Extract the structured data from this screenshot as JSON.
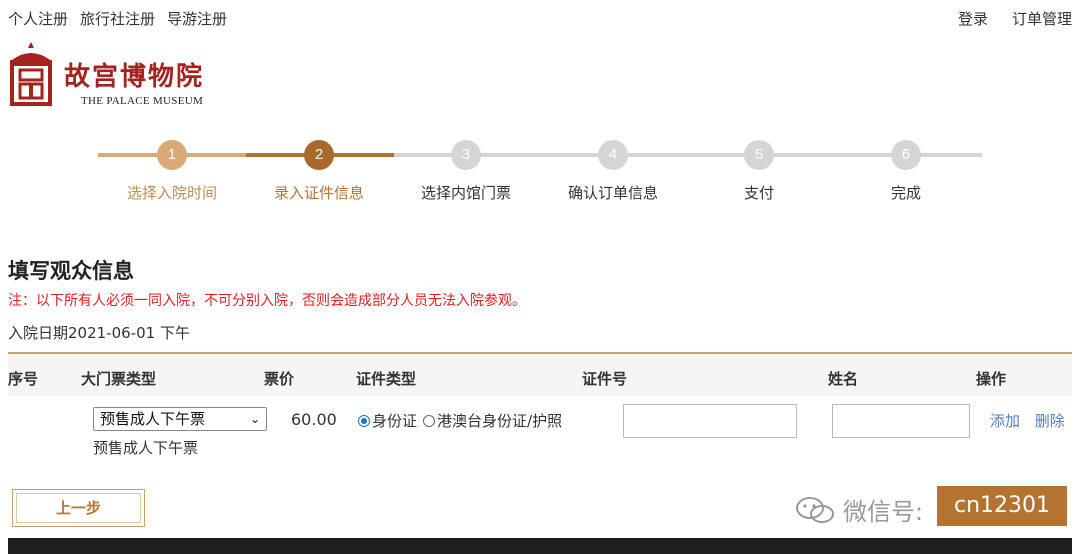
{
  "topnav": {
    "left": [
      "个人注册",
      "旅行社注册",
      "导游注册"
    ],
    "right": [
      "登录",
      "订单管理"
    ]
  },
  "logo": {
    "cn": "故宫博物院",
    "en": "THE PALACE MUSEUM"
  },
  "steps": [
    {
      "num": "1",
      "label": "选择入院时间",
      "state": "done"
    },
    {
      "num": "2",
      "label": "录入证件信息",
      "state": "active"
    },
    {
      "num": "3",
      "label": "选择内馆门票",
      "state": "todo"
    },
    {
      "num": "4",
      "label": "确认订单信息",
      "state": "todo"
    },
    {
      "num": "5",
      "label": "支付",
      "state": "todo"
    },
    {
      "num": "6",
      "label": "完成",
      "state": "todo"
    }
  ],
  "section": {
    "title": "填写观众信息",
    "notice": "注：以下所有人必须一同入院，不可分别入院，否则会造成部分人员无法入院参观。",
    "date": "入院日期2021-06-01 下午"
  },
  "table": {
    "headers": [
      "序号",
      "大门票类型",
      "票价",
      "证件类型",
      "证件号",
      "姓名",
      "操作"
    ],
    "row": {
      "ticket_select": "预售成人下午票",
      "ticket_name": "预售成人下午票",
      "price": "60.00",
      "id_type_1": "身份证",
      "id_type_2": "港澳台身份证/护照",
      "op_add": "添加",
      "op_delete": "删除"
    }
  },
  "buttons": {
    "prev": "上一步",
    "next": "cn12301"
  },
  "watermark": {
    "text": "微信号:"
  },
  "colors": {
    "accent": "#b47330",
    "done": "#d9aa78",
    "todo": "#d5d5d5",
    "notice": "#e02020",
    "link": "#4b7fc4"
  }
}
